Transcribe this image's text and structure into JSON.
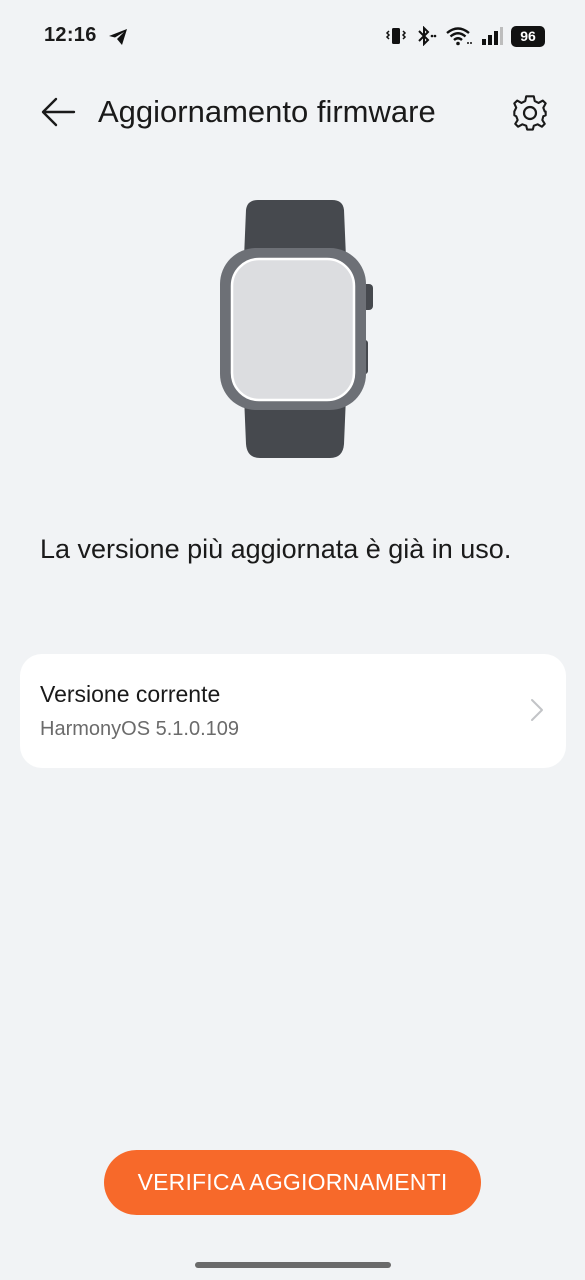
{
  "status_bar": {
    "time": "12:16",
    "battery": "96",
    "icons": [
      "telegram-icon",
      "vibrate-icon",
      "bluetooth-icon",
      "wifi-icon",
      "signal-icon",
      "battery-icon"
    ]
  },
  "header": {
    "title": "Aggiornamento firmware",
    "back_icon": "back-arrow-icon",
    "settings_icon": "gear-icon"
  },
  "device": {
    "illustration": "smartwatch-icon"
  },
  "main": {
    "status_message": "La versione più aggiornata è già in uso."
  },
  "version_card": {
    "label": "Versione corrente",
    "value": "HarmonyOS 5.1.0.109",
    "icon": "chevron-right-icon"
  },
  "actions": {
    "check_updates_label": "VERIFICA AGGIORNAMENTI"
  },
  "colors": {
    "accent": "#f7692a",
    "background": "#f1f3f5",
    "card": "#ffffff"
  }
}
